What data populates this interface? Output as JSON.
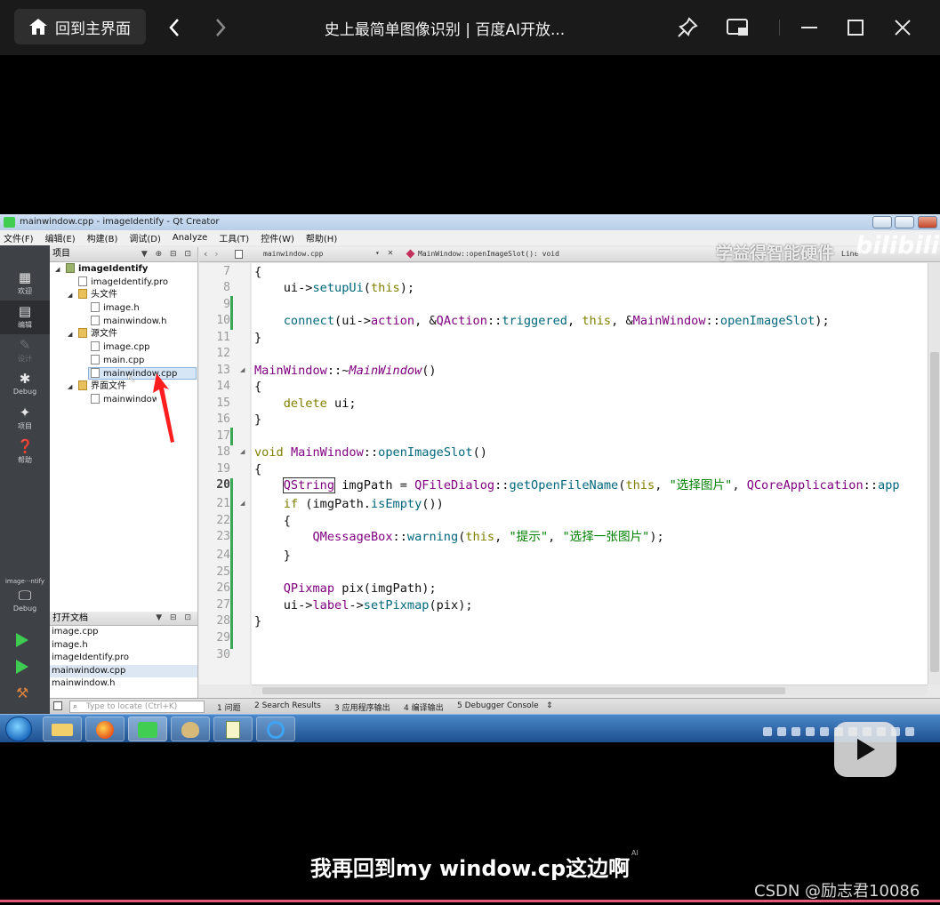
{
  "topbar": {
    "home_label": "回到主界面",
    "title": "史上最简单图像识别 | 百度AI开放..."
  },
  "qt": {
    "window_title": "mainwindow.cpp - imageIdentify - Qt Creator",
    "menus": [
      "文件(F)",
      "编辑(E)",
      "构建(B)",
      "调试(D)",
      "Analyze",
      "工具(T)",
      "控件(W)",
      "帮助(H)"
    ],
    "modes": [
      {
        "label": "欢迎",
        "icon": "grid-icon"
      },
      {
        "label": "编辑",
        "icon": "edit-icon"
      },
      {
        "label": "设计",
        "icon": "pencil-icon"
      },
      {
        "label": "Debug",
        "icon": "bug-icon"
      },
      {
        "label": "项目",
        "icon": "wrench-icon"
      },
      {
        "label": "帮助",
        "icon": "help-icon"
      }
    ],
    "kit": {
      "label": "image···ntify",
      "sub": "Debug"
    },
    "project_pane_title": "项目",
    "tree": {
      "project": "imageIdentify",
      "pro_file": "imageIdentify.pro",
      "headers_folder": "头文件",
      "header_1": "image.h",
      "header_2": "mainwindow.h",
      "sources_folder": "源文件",
      "source_1": "image.cpp",
      "source_2": "main.cpp",
      "source_3": "mainwindow.cpp",
      "forms_folder": "界面文件",
      "form_1": "mainwindow.ui"
    },
    "open_docs_title": "打开文档",
    "open_docs": [
      "image.cpp",
      "image.h",
      "imageIdentify.pro",
      "mainwindow.cpp",
      "mainwindow.h"
    ],
    "editor": {
      "file_tab": "mainwindow.cpp",
      "symbol": "MainWindow::openImageSlot(): void",
      "right_label": "Line"
    },
    "line_numbers": [
      "7",
      "8",
      "9",
      "10",
      "11",
      "12",
      "13",
      "14",
      "15",
      "16",
      "17",
      "18",
      "19",
      "20",
      "21",
      "22",
      "23",
      "24",
      "25",
      "26",
      "27",
      "28",
      "29",
      "30"
    ],
    "current_line": "20",
    "locate_placeholder": "Type to locate (Ctrl+K)",
    "output_tabs": [
      "1 问题",
      "2 Search Results",
      "3 应用程序输出",
      "4 编译输出",
      "5 Debugger Console"
    ]
  },
  "watermark": {
    "brand": "学益得智能硬件",
    "logo": "bilibili"
  },
  "subtitle": "我再回到my window.cp这边啊",
  "ai_mark": "AI",
  "csdn": "CSDN @励志君10086",
  "colors": {
    "keyword": "#808000",
    "type": "#800080",
    "function": "#00677c",
    "string": "#008000"
  }
}
